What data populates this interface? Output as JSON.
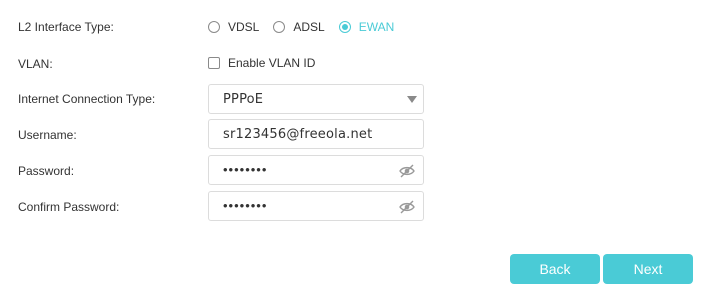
{
  "form": {
    "l2_interface": {
      "label": "L2 Interface Type:",
      "options": [
        {
          "label": "VDSL",
          "checked": false
        },
        {
          "label": "ADSL",
          "checked": false
        },
        {
          "label": "EWAN",
          "checked": true
        }
      ]
    },
    "vlan": {
      "label": "VLAN:",
      "checkbox_label": "Enable VLAN ID",
      "checked": false
    },
    "connection_type": {
      "label": "Internet Connection Type:",
      "value": "PPPoE"
    },
    "username": {
      "label": "Username:",
      "value": "sr123456@freeola.net"
    },
    "password": {
      "label": "Password:",
      "masked_value": "••••••••"
    },
    "confirm_password": {
      "label": "Confirm Password:",
      "masked_value": "••••••••"
    }
  },
  "buttons": {
    "back": "Back",
    "next": "Next"
  },
  "colors": {
    "accent": "#4acbd6",
    "border": "#dcdcdc",
    "text": "#333333"
  },
  "icons": {
    "select_caret": "triangle-down-icon",
    "password_toggle": "eye-slash-icon"
  }
}
